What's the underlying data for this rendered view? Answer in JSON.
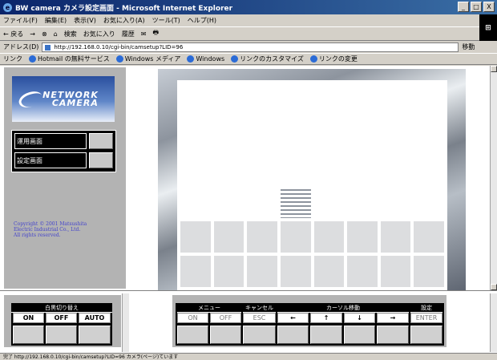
{
  "window": {
    "title": "BW camera カメラ設定画面 - Microsoft Internet Explorer",
    "controls": [
      "_",
      "□",
      "X"
    ]
  },
  "menu": [
    "ファイル(F)",
    "編集(E)",
    "表示(V)",
    "お気に入り(A)",
    "ツール(T)",
    "ヘルプ(H)"
  ],
  "toolbar": {
    "back": "← 戻る",
    "items": [
      "→",
      "⊗",
      "⌂",
      "検索",
      "お気に入り",
      "履歴",
      "✉",
      "🖶"
    ]
  },
  "address": {
    "label": "アドレス(D)",
    "url": "http://192.168.0.10/cgi-bin/camsetup?LID=96",
    "go": "移動"
  },
  "links": {
    "label": "リンク",
    "items": [
      "Hotmail の無料サービス",
      "Windows メディア",
      "Windows",
      "リンクのカスタマイズ",
      "リンクの変更"
    ]
  },
  "logo": {
    "line1": "NETWORK",
    "line2": "CAMERA"
  },
  "modes": [
    {
      "label": "運用画面"
    },
    {
      "label": "設定画面"
    }
  ],
  "copyright": [
    "Copyright © 2001 Matsushita",
    "Electric Industrial Co., Ltd.",
    "All rights reserved."
  ],
  "grid": {
    "rows": [
      [
        "off",
        "off",
        "off",
        "off",
        "off",
        "off",
        "off",
        "off"
      ],
      [
        "off",
        "off",
        "on",
        "off",
        "off",
        "off",
        "off",
        "off"
      ],
      [
        "off",
        "off",
        "on",
        "on",
        "off",
        "off",
        "off",
        "off"
      ],
      [
        "off",
        "off",
        "off",
        "sel",
        "off",
        "off",
        "off",
        "off"
      ],
      [
        "dk",
        "dk",
        "dk",
        "dk",
        "dk",
        "dk",
        "dk",
        "dk"
      ],
      [
        "dk",
        "dk",
        "dk",
        "dk",
        "dk",
        "dk",
        "dk",
        "dk"
      ]
    ]
  },
  "bw_control": {
    "header": "白黒切り替え",
    "buttons": [
      "ON",
      "OFF",
      "AUTO"
    ]
  },
  "main_control": {
    "menu_header": "メニュー",
    "cancel_header": "キャンセル",
    "cursor_header": "カーソル移動",
    "set_header": "設定",
    "buttons": [
      "ON",
      "OFF",
      "ESC",
      "←",
      "↑",
      "↓",
      "→",
      "ENTER"
    ]
  },
  "status": {
    "text": "完了 http://192.168.0.10/cgi-bin/camsetup?LID=96 カメラ(ページ)ています"
  }
}
